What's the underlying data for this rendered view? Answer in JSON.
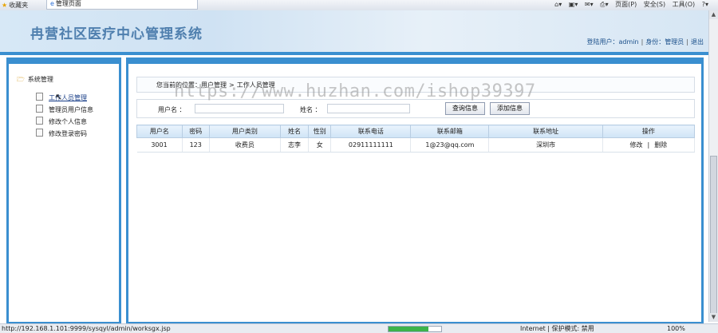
{
  "browser": {
    "favorites_label": "收藏夹",
    "tab_title": "管理页面",
    "tools": [
      "页面(P)",
      "安全(S)",
      "工具(O)"
    ],
    "help_icon": "help-icon"
  },
  "header": {
    "title": "冉营社区医疗中心管理系统",
    "login_user": "登陆用户：admin",
    "identity": "身份：管理员",
    "logout": "退出"
  },
  "sidebar": {
    "root": "系统管理",
    "items": [
      {
        "label": "工作人员管理",
        "active": true
      },
      {
        "label": "管理员用户信息",
        "active": false
      },
      {
        "label": "修改个人信息",
        "active": false
      },
      {
        "label": "修改登录密码",
        "active": false
      }
    ]
  },
  "breadcrumb": {
    "prefix": "您当前的位置：",
    "level1": "用户管理",
    "sep": ">",
    "level2": "工作人员管理"
  },
  "search": {
    "username_label": "用户名 ：",
    "username_value": "",
    "name_label": "姓名 ：",
    "name_value": "",
    "query_button": "查询信息",
    "add_button": "添加信息"
  },
  "table": {
    "headers": [
      "用户名",
      "密码",
      "用户类别",
      "姓名",
      "性别",
      "联系电话",
      "联系邮箱",
      "联系地址",
      "操作"
    ],
    "rows": [
      {
        "username": "3001",
        "password": "123",
        "category": "收费员",
        "name": "志李",
        "gender": "女",
        "phone": "02911111111",
        "email": "1@23@qq.com",
        "address": "深圳市",
        "edit": "修改",
        "sep": "|",
        "delete": "删除"
      }
    ]
  },
  "watermark": "https://www.huzhan.com/ishop39397",
  "status": {
    "url": "http://192.168.1.101:9999/sysqyl/admin/worksgx.jsp",
    "progress": 0.75,
    "zone": "Internet | 保护模式: 禁用",
    "zoom": "100%"
  }
}
